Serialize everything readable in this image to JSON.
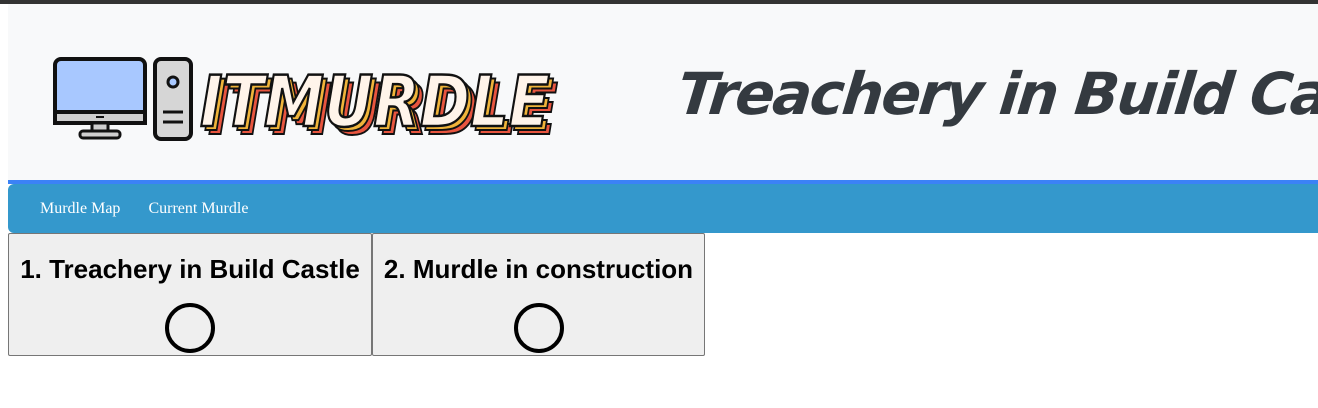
{
  "header": {
    "logo_text": "ITMURDLE",
    "page_title": "Treachery in Build Castle"
  },
  "nav": {
    "items": [
      {
        "label": "Murdle Map"
      },
      {
        "label": "Current Murdle"
      }
    ]
  },
  "cards": [
    {
      "title": "1. Treachery in Build Castle",
      "status_icon": "empty-circle-icon"
    },
    {
      "title": "2. Murdle in construction",
      "status_icon": "empty-circle-icon"
    }
  ],
  "colors": {
    "nav_background": "#3498cc",
    "header_background": "#f8f9fa",
    "header_border": "#3b82f6",
    "title_color": "#343a40",
    "card_background": "#efefef"
  }
}
